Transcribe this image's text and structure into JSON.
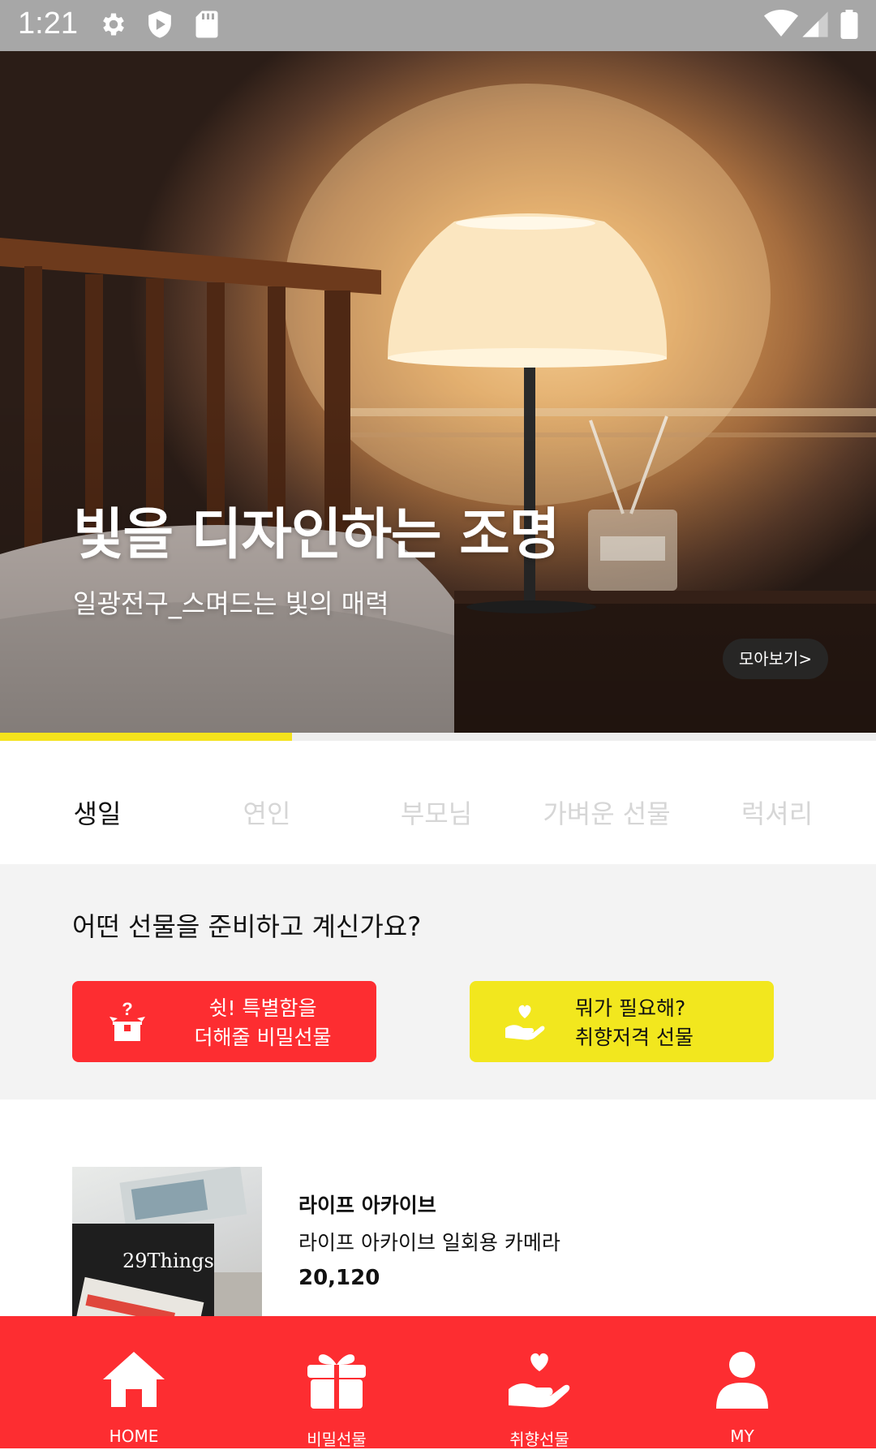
{
  "status_bar": {
    "time": "1:21"
  },
  "hero": {
    "title": "빛을 디자인하는 조명",
    "subtitle": "일광전구_스며드는 빛의 매력",
    "more_label": "모아보기>",
    "slide_progress": 0.333
  },
  "tabs": [
    {
      "label": "생일",
      "active": true
    },
    {
      "label": "연인",
      "active": false
    },
    {
      "label": "부모님",
      "active": false
    },
    {
      "label": "가벼운 선물",
      "active": false
    },
    {
      "label": "럭셔리",
      "active": false
    }
  ],
  "question": {
    "text": "어떤 선물을 준비하고 계신가요?",
    "secret_button": {
      "line1": "쉿! 특별함을",
      "line2": "더해줄 비밀선물",
      "icon": "secret-gift-box-icon",
      "color": "#fd2d31"
    },
    "taste_button": {
      "line1": "뭐가 필요해?",
      "line2": "취향저격 선물",
      "icon": "hand-heart-icon",
      "color": "#f2e71e"
    }
  },
  "product": {
    "thumb_label": "29Things",
    "brand": "라이프 아카이브",
    "name": "라이프 아카이브 일회용 카메라",
    "price": "20,120"
  },
  "bottom_nav": [
    {
      "label": "HOME",
      "icon": "home-icon"
    },
    {
      "label": "비밀선물",
      "icon": "gift-icon"
    },
    {
      "label": "취향선물",
      "icon": "hand-heart-icon"
    },
    {
      "label": "MY",
      "icon": "user-icon"
    }
  ],
  "colors": {
    "accent_red": "#fd2d31",
    "accent_yellow": "#f2e71e",
    "progress_yellow": "#f4e21c"
  }
}
